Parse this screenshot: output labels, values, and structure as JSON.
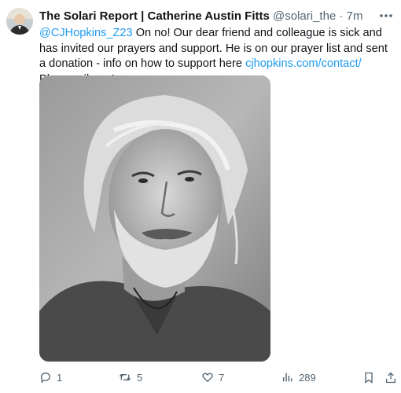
{
  "tweet": {
    "author_name": "The Solari Report | Catherine Austin Fitts",
    "handle": "@solari_the",
    "separator": "·",
    "time": "7m",
    "mention": "@CJHopkins_Z23",
    "body_part1": " On no! Our dear friend and colleague is sick and has invited our prayers and support. He is on our prayer list and sent a donation - info on how to support here ",
    "link_text": "cjhopkins.com/contact/",
    "body_part2": " Please pile on!"
  },
  "actions": {
    "replies": "1",
    "reposts": "5",
    "likes": "7",
    "views": "289"
  },
  "icons": {
    "more": "more-horizontal-icon",
    "reply": "reply-icon",
    "repost": "repost-icon",
    "like": "heart-icon",
    "views": "views-chart-icon",
    "bookmark": "bookmark-icon",
    "share": "share-icon"
  },
  "colors": {
    "link": "#1d9bf0",
    "secondary_text": "#536471",
    "primary_text": "#0f1419"
  }
}
